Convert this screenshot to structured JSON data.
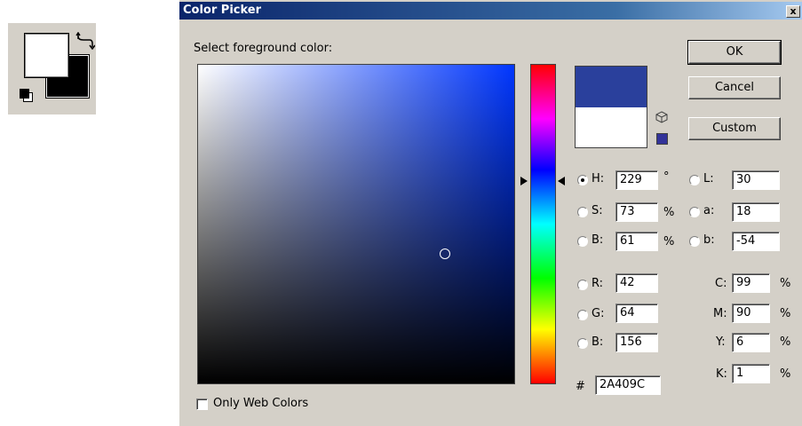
{
  "dialog": {
    "title": "Color Picker",
    "close_glyph": "x",
    "prompt": "Select foreground color:",
    "buttons": {
      "ok": "OK",
      "cancel": "Cancel",
      "custom": "Custom"
    },
    "new_color": "#2A409C",
    "current_color": "#FFFFFF",
    "websafe_color": "#333399",
    "hsb": {
      "h": {
        "label": "H:",
        "value": "229",
        "unit": "°",
        "checked": true
      },
      "s": {
        "label": "S:",
        "value": "73",
        "unit": "%",
        "checked": false
      },
      "b": {
        "label": "B:",
        "value": "61",
        "unit": "%",
        "checked": false
      }
    },
    "lab": {
      "l": {
        "label": "L:",
        "value": "30"
      },
      "a": {
        "label": "a:",
        "value": "18"
      },
      "b": {
        "label": "b:",
        "value": "-54"
      }
    },
    "rgb": {
      "r": {
        "label": "R:",
        "value": "42"
      },
      "g": {
        "label": "G:",
        "value": "64"
      },
      "b": {
        "label": "B:",
        "value": "156"
      }
    },
    "cmyk": {
      "c": {
        "label": "C:",
        "value": "99",
        "unit": "%"
      },
      "m": {
        "label": "M:",
        "value": "90",
        "unit": "%"
      },
      "y": {
        "label": "Y:",
        "value": "6",
        "unit": "%"
      },
      "k": {
        "label": "K:",
        "value": "1",
        "unit": "%"
      }
    },
    "hex": {
      "label": "#",
      "value": "2A409C"
    },
    "only_web_colors": {
      "label": "Only Web Colors",
      "checked": false
    }
  },
  "tool_swatch": {
    "foreground": "#FFFFFF",
    "background": "#000000"
  }
}
